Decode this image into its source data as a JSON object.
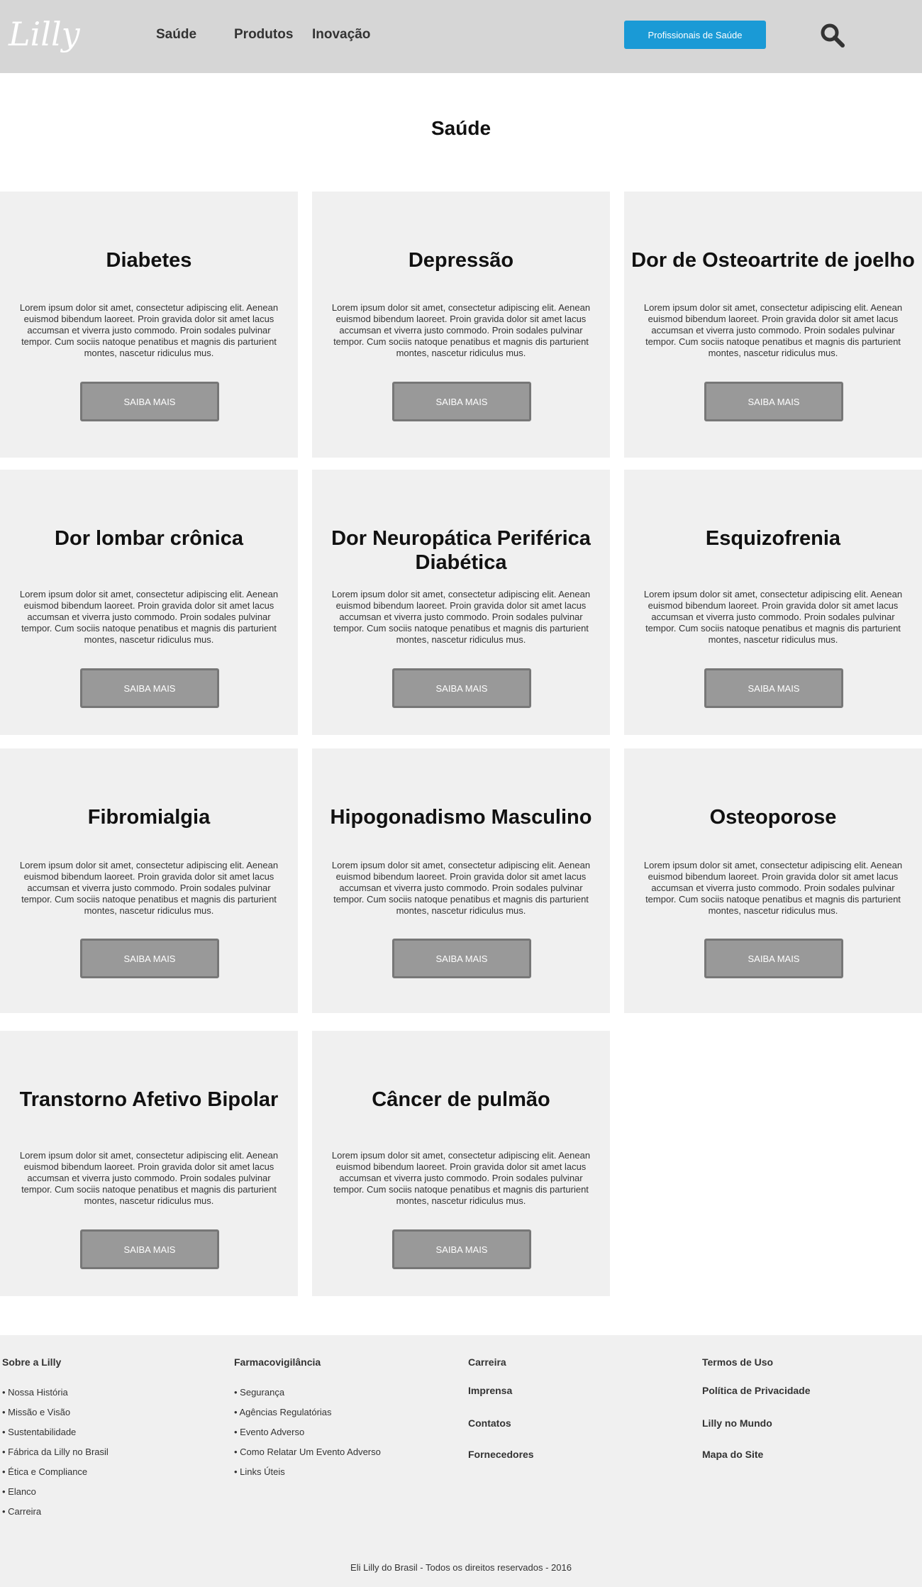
{
  "header": {
    "logo_text": "Lilly",
    "nav": [
      "Saúde",
      "Produtos",
      "Inovação"
    ],
    "hcp_button": "Profissionais de Saúde",
    "search_icon": "search-icon"
  },
  "page": {
    "title": "Saúde"
  },
  "cards": [
    {
      "title": "Diabetes",
      "text": "Lorem ipsum dolor sit amet, consectetur adipiscing elit. Aenean euismod bibendum laoreet. Proin gravida dolor sit amet lacus accumsan et viverra justo commodo. Proin sodales pulvinar tempor. Cum sociis natoque penatibus et magnis dis parturient montes, nascetur ridiculus mus.",
      "button": "SAIBA MAIS"
    },
    {
      "title": "Depressão",
      "text": "Lorem ipsum dolor sit amet, consectetur adipiscing elit. Aenean euismod bibendum laoreet. Proin gravida dolor sit amet lacus accumsan et viverra justo commodo. Proin sodales pulvinar tempor. Cum sociis natoque penatibus et magnis dis parturient montes, nascetur ridiculus mus.",
      "button": "SAIBA MAIS"
    },
    {
      "title": "Dor de Osteoartrite de joelho",
      "text": "Lorem ipsum dolor sit amet, consectetur adipiscing elit. Aenean euismod bibendum laoreet. Proin gravida dolor sit amet lacus accumsan et viverra justo commodo. Proin sodales pulvinar tempor. Cum sociis natoque penatibus et magnis dis parturient montes, nascetur ridiculus mus.",
      "button": "SAIBA MAIS"
    },
    {
      "title": "Dor lombar crônica",
      "text": "Lorem ipsum dolor sit amet, consectetur adipiscing elit. Aenean euismod bibendum laoreet. Proin gravida dolor sit amet lacus accumsan et viverra justo commodo. Proin sodales pulvinar tempor. Cum sociis natoque penatibus et magnis dis parturient montes, nascetur ridiculus mus.",
      "button": "SAIBA MAIS"
    },
    {
      "title": "Dor Neuropática Periférica Diabética",
      "text": "Lorem ipsum dolor sit amet, consectetur adipiscing elit. Aenean euismod bibendum laoreet. Proin gravida dolor sit amet lacus accumsan et viverra justo commodo. Proin sodales pulvinar tempor. Cum sociis natoque penatibus et magnis dis parturient montes, nascetur ridiculus mus.",
      "button": "SAIBA MAIS"
    },
    {
      "title": "Esquizofrenia",
      "text": "Lorem ipsum dolor sit amet, consectetur adipiscing elit. Aenean euismod bibendum laoreet. Proin gravida dolor sit amet lacus accumsan et viverra justo commodo. Proin sodales pulvinar tempor. Cum sociis natoque penatibus et magnis dis parturient montes, nascetur ridiculus mus.",
      "button": "SAIBA MAIS"
    },
    {
      "title": "Fibromialgia",
      "text": "Lorem ipsum dolor sit amet, consectetur adipiscing elit. Aenean euismod bibendum laoreet. Proin gravida dolor sit amet lacus accumsan et viverra justo commodo. Proin sodales pulvinar tempor. Cum sociis natoque penatibus et magnis dis parturient montes, nascetur ridiculus mus.",
      "button": "SAIBA MAIS"
    },
    {
      "title": "Hipogonadismo Masculino",
      "text": "Lorem ipsum dolor sit amet, consectetur adipiscing elit. Aenean euismod bibendum laoreet. Proin gravida dolor sit amet lacus accumsan et viverra justo commodo. Proin sodales pulvinar tempor. Cum sociis natoque penatibus et magnis dis parturient montes, nascetur ridiculus mus.",
      "button": "SAIBA MAIS"
    },
    {
      "title": "Osteoporose",
      "text": "Lorem ipsum dolor sit amet, consectetur adipiscing elit. Aenean euismod bibendum laoreet. Proin gravida dolor sit amet lacus accumsan et viverra justo commodo. Proin sodales pulvinar tempor. Cum sociis natoque penatibus et magnis dis parturient montes, nascetur ridiculus mus.",
      "button": "SAIBA MAIS"
    },
    {
      "title": "Transtorno Afetivo Bipolar",
      "text": "Lorem ipsum dolor sit amet, consectetur adipiscing elit. Aenean euismod bibendum laoreet. Proin gravida dolor sit amet lacus accumsan et viverra justo commodo. Proin sodales pulvinar tempor. Cum sociis natoque penatibus et magnis dis parturient montes, nascetur ridiculus mus.",
      "button": "SAIBA MAIS"
    },
    {
      "title": "Câncer de pulmão",
      "text": "Lorem ipsum dolor sit amet, consectetur adipiscing elit. Aenean euismod bibendum laoreet. Proin gravida dolor sit amet lacus accumsan et viverra justo commodo. Proin sodales pulvinar tempor. Cum sociis natoque penatibus et magnis dis parturient montes, nascetur ridiculus mus.",
      "button": "SAIBA MAIS"
    }
  ],
  "footer": {
    "col1": {
      "heading": "Sobre a Lilly",
      "items": [
        "• Nossa História",
        "• Missão e Visão",
        "• Sustentabilidade",
        "• Fábrica da Lilly no Brasil",
        "• Ética e Compliance",
        "• Elanco",
        "• Carreira"
      ]
    },
    "col2": {
      "heading": "Farmacovigilância",
      "items": [
        "• Segurança",
        "• Agências Regulatórias",
        "• Evento Adverso",
        "• Como Relatar Um Evento Adverso",
        "• Links Úteis"
      ]
    },
    "col3": [
      "Carreira",
      "Imprensa",
      "Contatos",
      "Fornecedores"
    ],
    "col4": [
      "Termos de Uso",
      "Política de Privacidade",
      "Lilly no Mundo",
      "Mapa do Site"
    ],
    "copyright": "Eli Lilly do Brasil - Todos os direitos reservados - 2016"
  }
}
